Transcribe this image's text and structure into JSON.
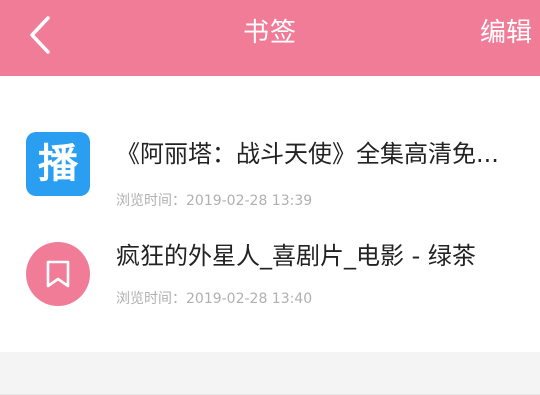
{
  "header": {
    "title": "书签",
    "edit_label": "编辑",
    "back_icon": "chevron-left-icon",
    "background": "#f17c98"
  },
  "bookmarks": [
    {
      "title": "《阿丽塔：战斗天使》全集高清免...",
      "time": "浏览时间：2019-02-28 13:39",
      "thumb_glyph": "播",
      "thumb_color": "#2a9ef0"
    },
    {
      "title": "疯狂的外星人_喜剧片_电影 - 绿茶",
      "time": "浏览时间：2019-02-28 13:40",
      "thumb_icon": "bookmark-icon",
      "thumb_color": "#f17c98"
    }
  ]
}
